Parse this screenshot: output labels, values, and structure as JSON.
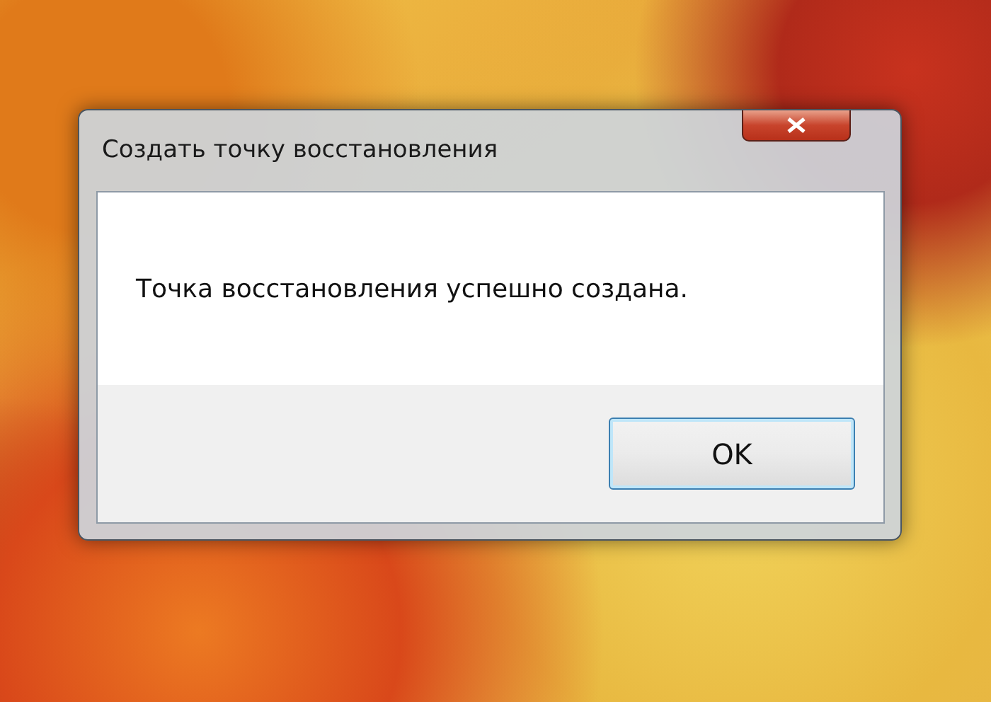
{
  "window": {
    "title": "Создать точку восстановления"
  },
  "message": "Точка восстановления успешно создана.",
  "buttons": [
    "OK"
  ]
}
